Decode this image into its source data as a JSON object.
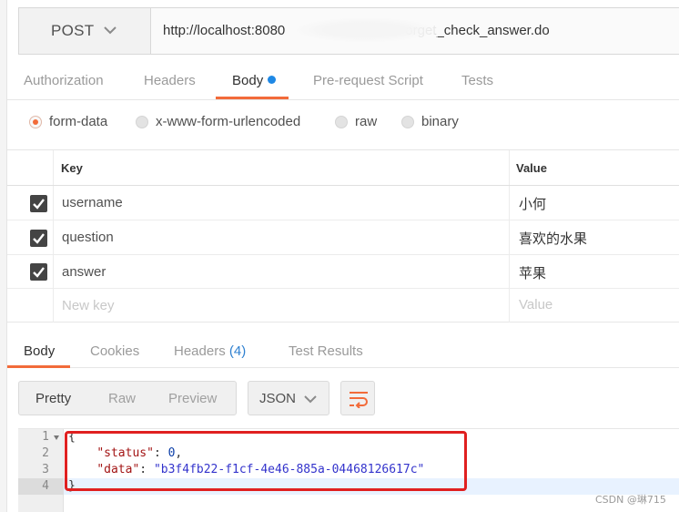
{
  "request": {
    "method": "POST",
    "url_prefix": "http://localhost:8080",
    "url_suffix": "orget_check_answer.do"
  },
  "request_tabs": [
    {
      "label": "Authorization",
      "active": false
    },
    {
      "label": "Headers",
      "active": false
    },
    {
      "label": "Body",
      "active": true
    },
    {
      "label": "Pre-request Script",
      "active": false
    },
    {
      "label": "Tests",
      "active": false
    }
  ],
  "body_types": [
    {
      "label": "form-data",
      "selected": true
    },
    {
      "label": "x-www-form-urlencoded",
      "selected": false
    },
    {
      "label": "raw",
      "selected": false
    },
    {
      "label": "binary",
      "selected": false
    }
  ],
  "params": {
    "key_header": "Key",
    "value_header": "Value",
    "rows": [
      {
        "key": "username",
        "value": "小何",
        "checked": true
      },
      {
        "key": "question",
        "value": "喜欢的水果",
        "checked": true
      },
      {
        "key": "answer",
        "value": "苹果",
        "checked": true
      }
    ],
    "new_key_placeholder": "New key",
    "new_value_placeholder": "Value"
  },
  "response_tabs": [
    {
      "label": "Body",
      "active": true
    },
    {
      "label": "Cookies",
      "active": false
    },
    {
      "label": "Headers",
      "count": "(4)",
      "active": false
    },
    {
      "label": "Test Results",
      "active": false
    }
  ],
  "view_modes": [
    {
      "label": "Pretty",
      "active": true
    },
    {
      "label": "Raw",
      "active": false
    },
    {
      "label": "Preview",
      "active": false
    }
  ],
  "format": "JSON",
  "code": {
    "line_numbers": [
      "1",
      "2",
      "3",
      "4"
    ],
    "open_brace": "{",
    "status_key": "\"status\"",
    "status_value": "0",
    "data_key": "\"data\"",
    "data_value": "\"b3f4fb22-f1cf-4e46-885a-04468126617c\"",
    "close_brace": "}"
  },
  "watermark": "CSDN @琳715",
  "colors": {
    "accent": "#f26b3a",
    "highlight_box": "#e02020",
    "dot": "#1e88e5"
  }
}
